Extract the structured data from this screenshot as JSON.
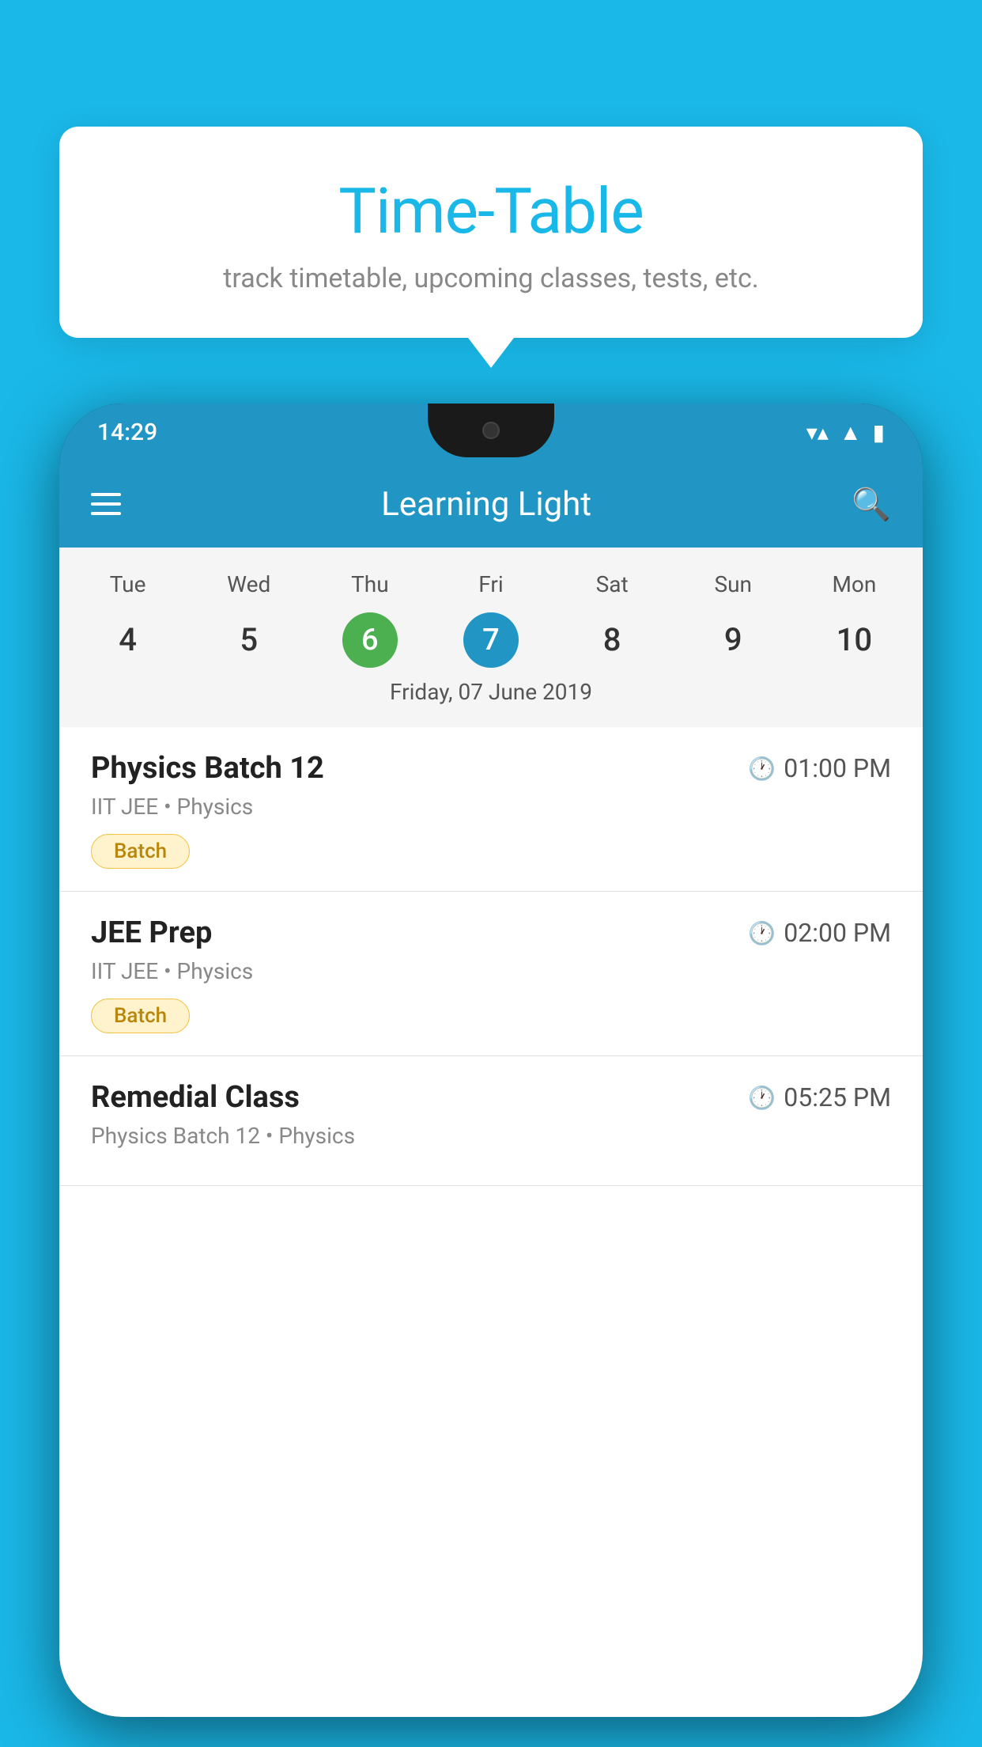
{
  "header": {
    "title": "Time-Table",
    "subtitle": "track timetable, upcoming classes, tests, etc."
  },
  "appbar": {
    "title": "Learning Light",
    "menu_label": "Menu",
    "search_label": "Search"
  },
  "status_bar": {
    "time": "14:29"
  },
  "calendar": {
    "days": [
      "Tue",
      "Wed",
      "Thu",
      "Fri",
      "Sat",
      "Sun",
      "Mon"
    ],
    "dates": [
      "4",
      "5",
      "6",
      "7",
      "8",
      "9",
      "10"
    ],
    "today_index": 2,
    "selected_index": 3,
    "selected_date": "Friday, 07 June 2019"
  },
  "schedule": [
    {
      "title": "Physics Batch 12",
      "time": "01:00 PM",
      "subtitle": "IIT JEE • Physics",
      "badge": "Batch"
    },
    {
      "title": "JEE Prep",
      "time": "02:00 PM",
      "subtitle": "IIT JEE • Physics",
      "badge": "Batch"
    },
    {
      "title": "Remedial Class",
      "time": "05:25 PM",
      "subtitle": "Physics Batch 12 • Physics",
      "badge": ""
    }
  ]
}
